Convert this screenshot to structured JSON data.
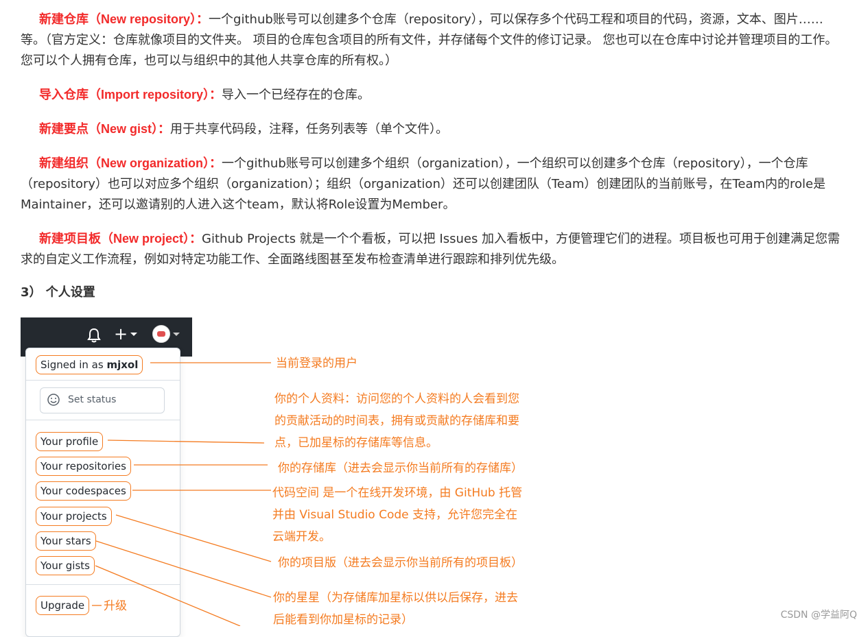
{
  "paragraphs": [
    {
      "label": "新建仓库（New repository）：",
      "text": "一个github账号可以创建多个仓库（repository），可以保存多个代码工程和项目的代码，资源，文本、图片……等。（官方定义：仓库就像项目的文件夹。 项目的仓库包含项目的所有文件，并存储每个文件的修订记录。 您也可以在仓库中讨论并管理项目的工作。您可以个人拥有仓库，也可以与组织中的其他人共享仓库的所有权。）"
    },
    {
      "label": "导入仓库（Import repository）：",
      "text": "导入一个已经存在的仓库。"
    },
    {
      "label": "新建要点（New gist）：",
      "text": "用于共享代码段，注释，任务列表等（单个文件）。"
    },
    {
      "label": "新建组织（New organization）：",
      "text": "一个github账号可以创建多个组织（organization），一个组织可以创建多个仓库（repository），一个仓库（repository）也可以对应多个组织（organization）；组织（organization）还可以创建团队（Team）创建团队的当前账号，在Team内的role是Maintainer，还可以邀请别的人进入这个team，默认将Role设置为Member。"
    },
    {
      "label": "新建项目板（New project）：",
      "text": "Github Projects 就是一个个看板，可以把 Issues 加入看板中，方便管理它们的进程。项目板也可用于创建满足您需求的自定义工作流程，例如对特定功能工作、全面路线图甚至发布检查清单进行跟踪和排列优先级。"
    }
  ],
  "heading": "3）  个人设置",
  "menu": {
    "signed_in_prefix": "Signed in as ",
    "username": "mjxol",
    "set_status": "Set status",
    "items": [
      "Your profile",
      "Your repositories",
      "Your codespaces",
      "Your projects",
      "Your stars",
      "Your gists"
    ],
    "upgrade": "Upgrade"
  },
  "annotations": {
    "user": "当前登录的用户",
    "profile": [
      "你的个人资料：访问您的个人资料的人会看到您",
      "的贡献活动的时间表，拥有或贡献的存储库和要",
      "点，已加星标的存储库等信息。"
    ],
    "repositories": "你的存储库（进去会显示你当前所有的存储库）",
    "codespaces": [
      "代码空间 是一个在线开发环境，由 GitHub 托管",
      "并由 Visual Studio Code 支持，允许您完全在",
      "云端开发。"
    ],
    "projects": "你的项目版（进去会显示你当前所有的项目板）",
    "stars": [
      "你的星星（为存储库加星标以供以后保存，进去",
      "后能看到你加星标的记录）"
    ],
    "upgrade": "升级"
  },
  "watermark": "CSDN @学益阿Q",
  "colors": {
    "highlight": "#f22a2a",
    "annotation": "#f47b20",
    "topbar": "#24292f"
  }
}
